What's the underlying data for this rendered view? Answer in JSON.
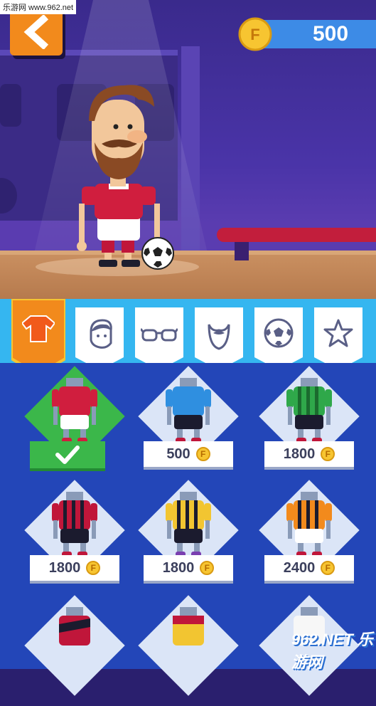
{
  "watermark": {
    "site": "乐游网 www.962.net",
    "corner_logo": "962.NET 乐游网"
  },
  "hud": {
    "coins": "500",
    "coin_letter": "F"
  },
  "colors": {
    "accent_orange": "#f28a1c",
    "coin_blue": "#3d8be6",
    "grid_blue": "#2346b8",
    "tab_blue": "#35b6f0",
    "selected_green": "#3bb74a"
  },
  "tabs": [
    {
      "name": "shirt",
      "icon": "shirt-icon",
      "selected": true
    },
    {
      "name": "hair",
      "icon": "hair-face-icon",
      "selected": false
    },
    {
      "name": "glasses",
      "icon": "glasses-icon",
      "selected": false
    },
    {
      "name": "beard",
      "icon": "beard-icon",
      "selected": false
    },
    {
      "name": "ball",
      "icon": "soccer-ball-icon",
      "selected": false
    },
    {
      "name": "celebration",
      "icon": "star-icon",
      "selected": false
    }
  ],
  "kits": [
    {
      "kind": "equipped",
      "price": ""
    },
    {
      "kind": "price",
      "price": "500"
    },
    {
      "kind": "price",
      "price": "1800"
    },
    {
      "kind": "price",
      "price": "1800"
    },
    {
      "kind": "price",
      "price": "1800"
    },
    {
      "kind": "price",
      "price": "2400"
    }
  ]
}
